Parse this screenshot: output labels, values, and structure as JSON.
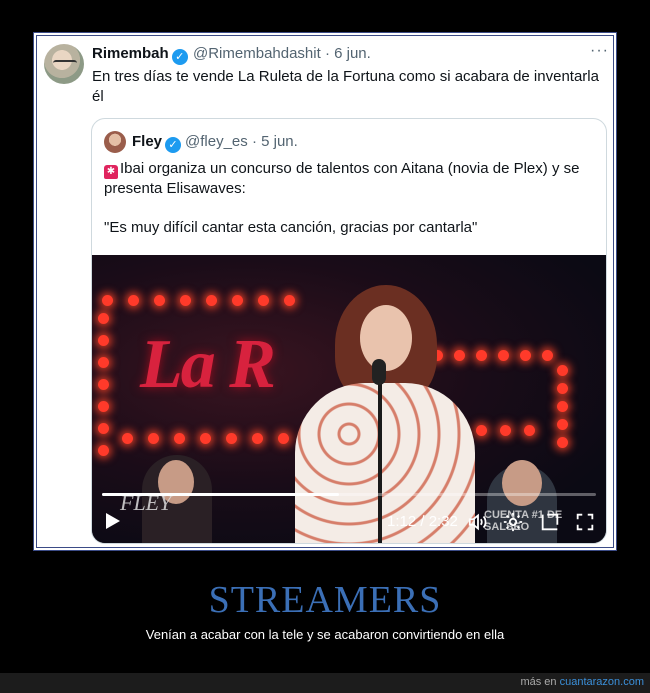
{
  "tweet": {
    "name": "Rimembah",
    "handle": "@Rimembahdashit",
    "separator": "·",
    "date": "6 jun.",
    "more": "···",
    "text": "En tres días te vende La Ruleta de la Fortuna como si acabara de inventarla él"
  },
  "quote": {
    "name": "Fley",
    "handle": "@fley_es",
    "separator": "·",
    "date": "5 jun.",
    "text": "Ibai organiza un concurso de talentos con Aitana (novia de Plex) y se presenta Elisawaves:",
    "quote_text": "\"Es muy difícil cantar esta canción, gracias por cantarla\""
  },
  "video": {
    "time": "1:12 / 2:32",
    "progress": 0.48,
    "watermark_left": "FLEY",
    "watermark_right": "CUENTA #1 DE SALSEO",
    "sign_text": "La R",
    "icons": [
      "play-icon",
      "volume-icon",
      "settings-icon",
      "popout-icon",
      "fullscreen-icon"
    ]
  },
  "post": {
    "title": "STREAMERS",
    "subtitle": "Venían a acabar con la tele y se acabaron convirtiendo en ella"
  },
  "footer": {
    "prefix": "más en",
    "site": "cuantarazon.com"
  },
  "colors": {
    "frame_border": "#3b4b86",
    "title": "#3b6fb6",
    "verified": "#1d9bf0",
    "link": "#3b8fd9"
  }
}
